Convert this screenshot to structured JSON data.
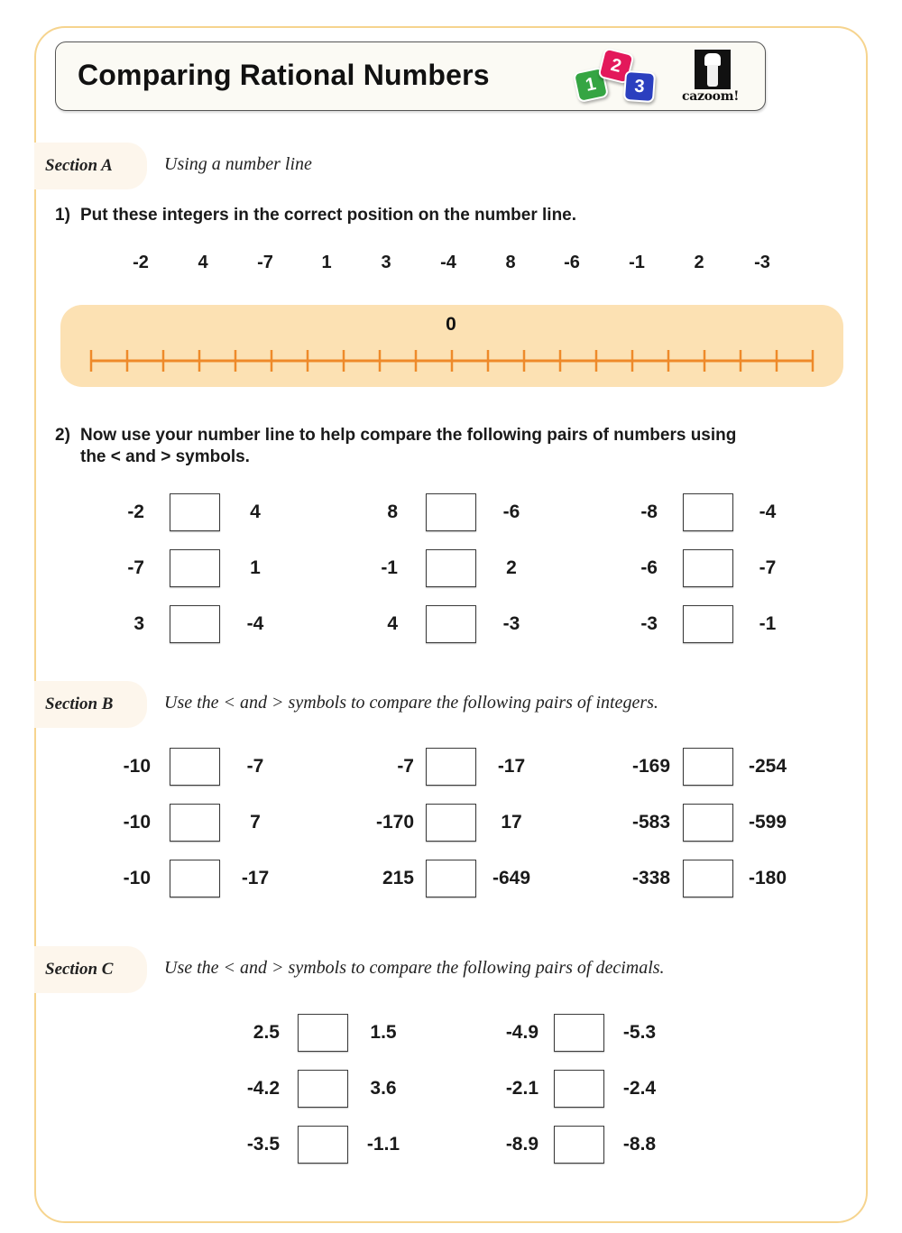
{
  "header": {
    "title": "Comparing Rational Numbers",
    "dice": [
      "1",
      "2",
      "3"
    ],
    "brand": "cazoom!"
  },
  "section_a": {
    "label": "Section A",
    "description": "Using a number line",
    "q1": {
      "number": "1)",
      "text": "Put these integers in the correct position on the number line.",
      "integers": [
        "-2",
        "4",
        "-7",
        "1",
        "3",
        "-4",
        "8",
        "-6",
        "-1",
        "2",
        "-3"
      ]
    },
    "number_line": {
      "zero_label": "0",
      "tick_count": 21,
      "color": "#ee8a2a",
      "panel_color": "#fce1b3"
    },
    "q2": {
      "number": "2)",
      "text_line1": "Now use your number line to help compare the following pairs of numbers using",
      "text_line2": "the < and > symbols.",
      "pairs": [
        [
          {
            "a": "-2",
            "b": "4"
          },
          {
            "a": "8",
            "b": "-6"
          },
          {
            "a": "-8",
            "b": "-4"
          }
        ],
        [
          {
            "a": "-7",
            "b": "1"
          },
          {
            "a": "-1",
            "b": "2"
          },
          {
            "a": "-6",
            "b": "-7"
          }
        ],
        [
          {
            "a": "3",
            "b": "-4"
          },
          {
            "a": "4",
            "b": "-3"
          },
          {
            "a": "-3",
            "b": "-1"
          }
        ]
      ]
    }
  },
  "section_b": {
    "label": "Section B",
    "description": "Use the < and > symbols to compare the following pairs of integers.",
    "pairs": [
      [
        {
          "a": "-10",
          "b": "-7"
        },
        {
          "a": "-7",
          "b": "-17"
        },
        {
          "a": "-169",
          "b": "-254"
        }
      ],
      [
        {
          "a": "-10",
          "b": "7"
        },
        {
          "a": "-170",
          "b": "17"
        },
        {
          "a": "-583",
          "b": "-599"
        }
      ],
      [
        {
          "a": "-10",
          "b": "-17"
        },
        {
          "a": "215",
          "b": "-649"
        },
        {
          "a": "-338",
          "b": "-180"
        }
      ]
    ]
  },
  "section_c": {
    "label": "Section C",
    "description": "Use the < and > symbols to compare the following pairs of decimals.",
    "pairs": [
      [
        {
          "a": "2.5",
          "b": "1.5"
        },
        {
          "a": "-4.9",
          "b": "-5.3"
        }
      ],
      [
        {
          "a": "-4.2",
          "b": "3.6"
        },
        {
          "a": "-2.1",
          "b": "-2.4"
        }
      ],
      [
        {
          "a": "-3.5",
          "b": "-1.1"
        },
        {
          "a": "-8.9",
          "b": "-8.8"
        }
      ]
    ]
  }
}
